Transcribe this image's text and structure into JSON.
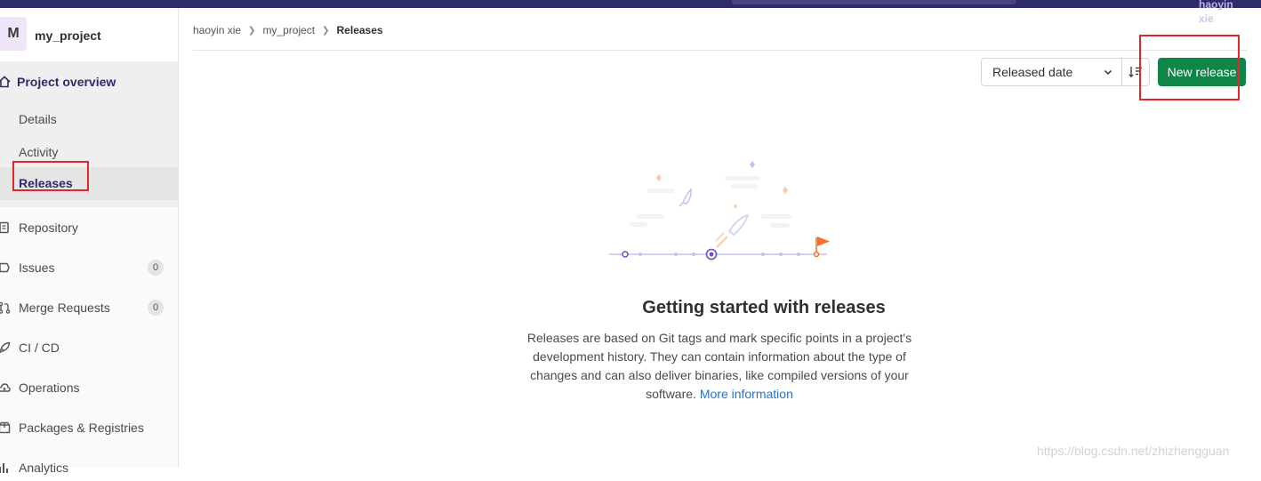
{
  "topbar": {
    "user_line1": "haoyin",
    "user_line2": "xie"
  },
  "project": {
    "avatar_letter": "M",
    "name": "my_project"
  },
  "sidebar": {
    "section_title": "Project overview",
    "sub_items": [
      "Details",
      "Activity",
      "Releases"
    ],
    "items": [
      {
        "label": "Repository",
        "icon": "book-icon"
      },
      {
        "label": "Issues",
        "icon": "issues-icon",
        "count": "0"
      },
      {
        "label": "Merge Requests",
        "icon": "merge-request-icon",
        "count": "0"
      },
      {
        "label": "CI / CD",
        "icon": "rocket-icon"
      },
      {
        "label": "Operations",
        "icon": "cloud-gear-icon"
      },
      {
        "label": "Packages & Registries",
        "icon": "package-icon"
      },
      {
        "label": "Analytics",
        "icon": "chart-icon"
      }
    ]
  },
  "breadcrumbs": {
    "items": [
      "haoyin xie",
      "my_project",
      "Releases"
    ]
  },
  "toolbar": {
    "sort_label": "Released date",
    "new_release_label": "New release"
  },
  "empty_state": {
    "title": "Getting started with releases",
    "description": "Releases are based on Git tags and mark specific points in a project's development history. They can contain information about the type of changes and can also deliver binaries, like compiled versions of your software.",
    "link_text": "More information"
  },
  "watermark": "https://blog.csdn.net/zhizhengguan",
  "colors": {
    "topbar": "#2f2a6b",
    "primary_button": "#108548",
    "highlight_box": "#e3262c",
    "link": "#1f75cb"
  }
}
